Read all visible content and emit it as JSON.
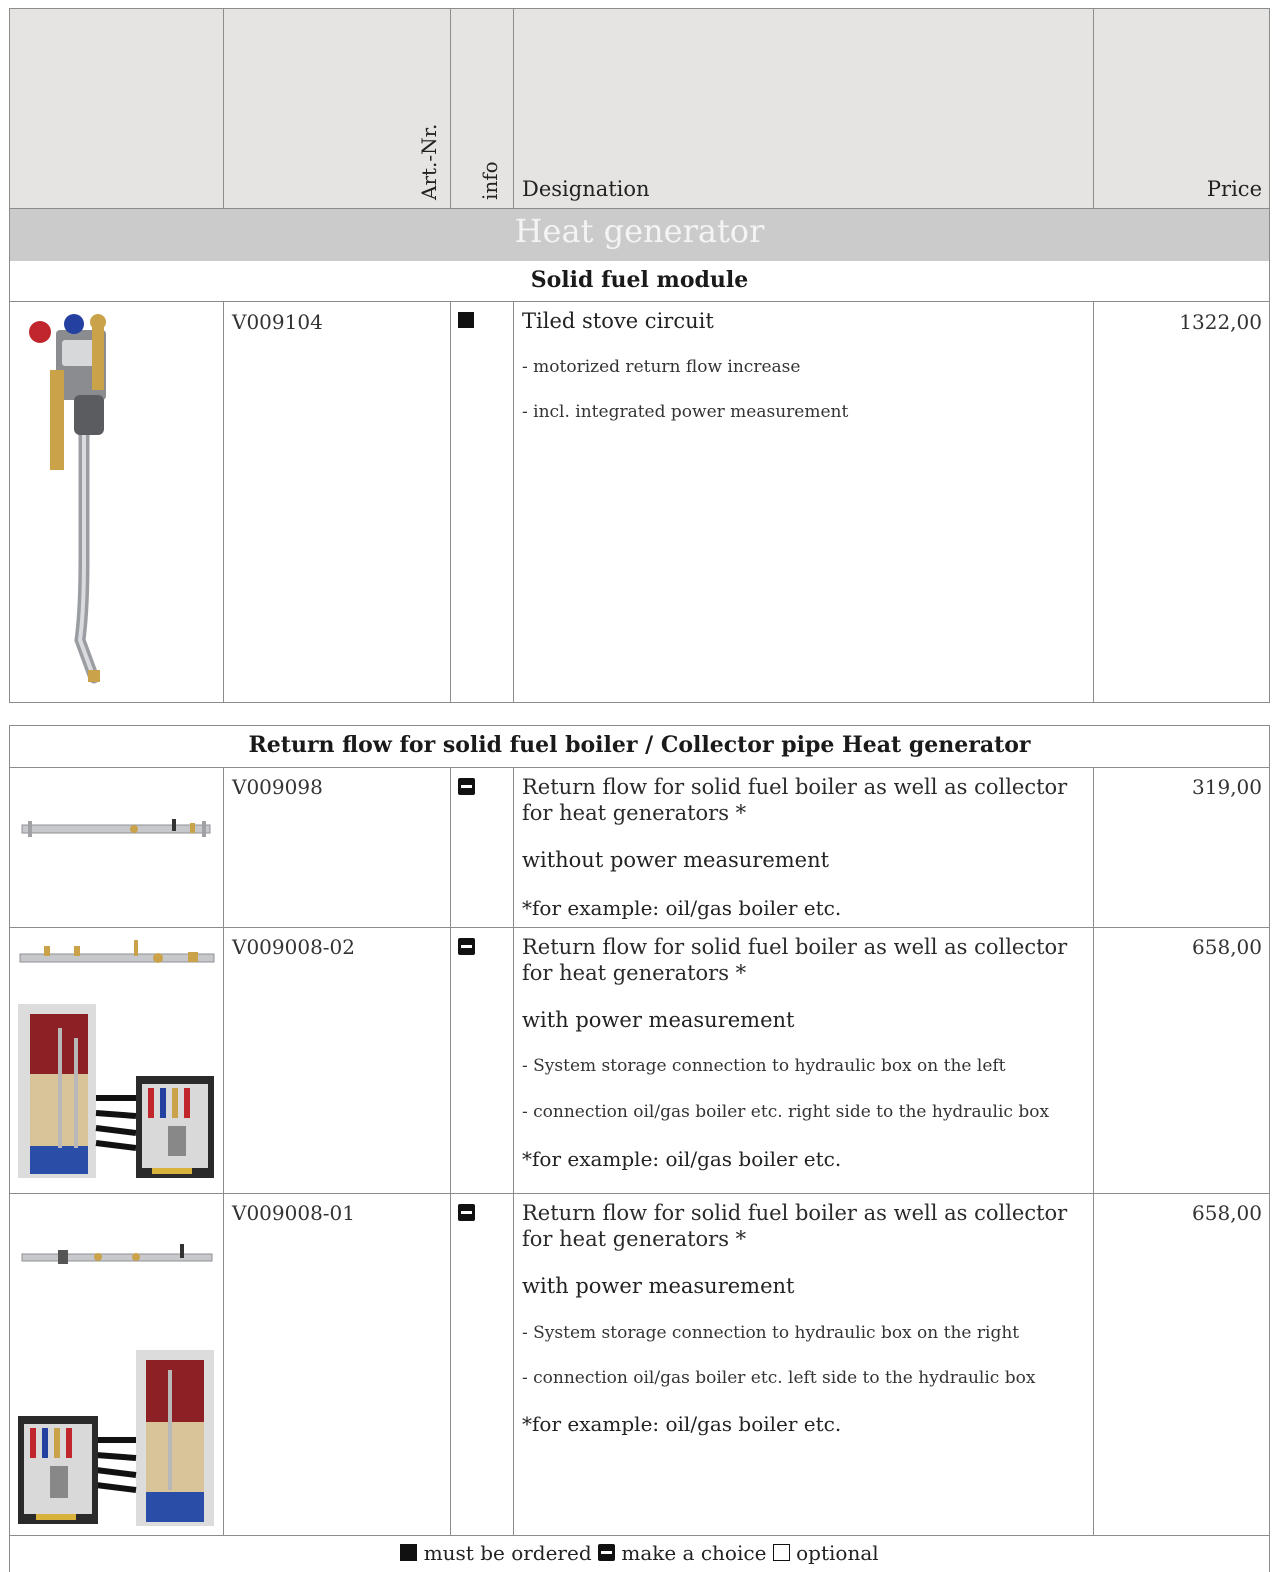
{
  "header": {
    "art_nr": "Art.-Nr.",
    "info": "info",
    "designation": "Designation",
    "price": "Price"
  },
  "category": "Heat generator",
  "section1": {
    "title": "Solid fuel module",
    "rows": [
      {
        "art_nr": "V009104",
        "info_icon": "square-filled-icon",
        "designation": "Tiled stove circuit",
        "details": [
          "- motorized return flow increase",
          "- incl. integrated power measurement"
        ],
        "price": "1322,00"
      }
    ]
  },
  "section2": {
    "title": "Return flow for solid fuel boiler / Collector pipe Heat generator",
    "rows": [
      {
        "art_nr": "V009098",
        "info_icon": "make-choice-icon",
        "designation": "Return flow for solid fuel boiler as well as collector for heat generators *",
        "line2": "without power measurement",
        "note": "*for example: oil/gas boiler etc.",
        "price": "319,00"
      },
      {
        "art_nr": "V009008-02",
        "info_icon": "make-choice-icon",
        "designation": "Return flow for solid fuel boiler as well as collector for heat generators *",
        "line2": "with power measurement",
        "details": [
          "- System storage connection to hydraulic box on the left",
          "- connection oil/gas boiler etc. right side to the hydraulic box"
        ],
        "note": "*for example: oil/gas boiler etc.",
        "price": "658,00"
      },
      {
        "art_nr": "V009008-01",
        "info_icon": "make-choice-icon",
        "designation": "Return flow for solid fuel boiler as well as collector for heat generators *",
        "line2": "with power measurement",
        "details": [
          "- System storage connection to hydraulic box on the right",
          "- connection oil/gas boiler etc. left side to the hydraulic box"
        ],
        "note": "*for example: oil/gas boiler etc.",
        "price": "658,00"
      }
    ]
  },
  "legend": {
    "must": "must be ordered",
    "choice": "make a choice",
    "optional": "optional"
  }
}
